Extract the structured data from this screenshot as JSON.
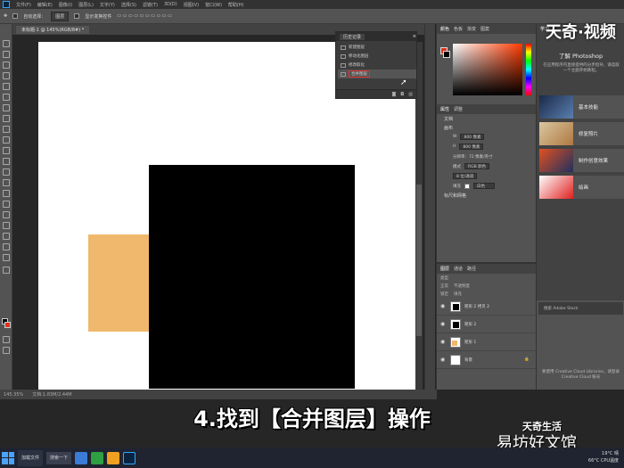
{
  "menubar": {
    "items": [
      "文件(F)",
      "编辑(E)",
      "图像(I)",
      "图层(L)",
      "文字(Y)",
      "选择(S)",
      "滤镜(T)",
      "3D(D)",
      "视图(V)",
      "窗口(W)",
      "帮助(H)"
    ]
  },
  "options": {
    "auto_select": "自动选择：",
    "auto_select_value": "图层",
    "show_transform": "显示变换控件"
  },
  "document_tab": "未标题-1 @ 145%(RGB/8#) *",
  "statusbar": {
    "zoom": "145.35%",
    "doc": "文档:1.83M/2.44M"
  },
  "history_panel": {
    "tab": "历史记录",
    "items": [
      "新建图层",
      "移动化图层",
      "修改取化",
      "合并图层"
    ],
    "selected_index": 3
  },
  "color_panel": {
    "tabs": [
      "颜色",
      "色板",
      "渐变",
      "图案"
    ],
    "foreground": "#e03020",
    "background": "#000000"
  },
  "properties_panel": {
    "tabs": [
      "属性",
      "调整"
    ],
    "doc_label": "文档",
    "section": "画布",
    "width": "800 像素",
    "height": "800 像素",
    "resolution": "分辨率：72 像素/英寸",
    "mode_label": "模式",
    "mode_value": "RGB 颜色",
    "bits": "8 位/通道",
    "fill_label": "填充",
    "fill_value": "白色",
    "rulers": "标尺和网格"
  },
  "layers_panel": {
    "tabs": [
      "图层",
      "通道",
      "路径"
    ],
    "kind": "类型",
    "blend": "正常",
    "opacity": "不透明度",
    "lock": "锁定",
    "fill": "填充",
    "layers": [
      {
        "name": "矩形 2 拷贝 2",
        "thumb": "dark"
      },
      {
        "name": "矩形 2",
        "thumb": "dark"
      },
      {
        "name": "矩形 1",
        "thumb": "orange"
      },
      {
        "name": "背景",
        "thumb": "white"
      }
    ]
  },
  "learn_panel": {
    "tab": "学习",
    "title": "了解 Photoshop",
    "desc": "在应用程序内直接提供的分步指导，请选取一个主题开始教程。",
    "cards": [
      "基本技能",
      "修复照片",
      "制作创意效果",
      "绘画"
    ],
    "lib_text": "要使用 Creative Cloud Libraries，请登录 Creative Cloud 账号",
    "lib_search": "搜索 Adobe Stock"
  },
  "watermark_top": "天奇·视频",
  "caption": "4.找到【合并图层】操作",
  "brand_small": "天奇生活",
  "brand_big": "易坊好文馆",
  "taskbar": {
    "item": "加载文件",
    "search": "搜索一下",
    "weather": "19°C 晴",
    "time": "66°C\nCPU温度"
  }
}
